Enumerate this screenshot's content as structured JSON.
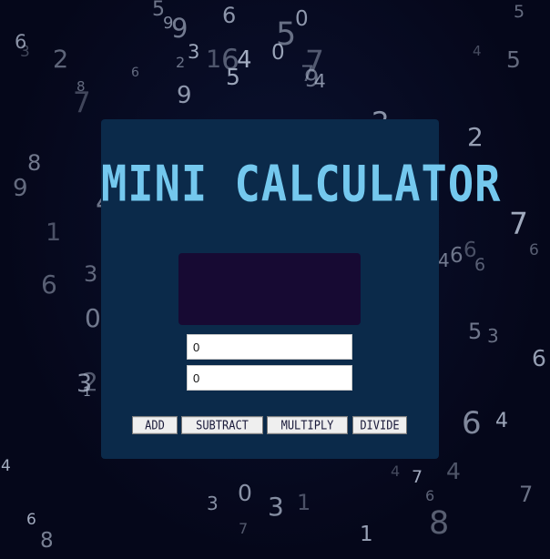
{
  "background_digits": [
    "7",
    "0",
    "1",
    "6",
    "0",
    "6",
    "7",
    "1",
    "6",
    "9",
    "3",
    "6",
    "8",
    "4",
    "3",
    "5",
    "6",
    "0",
    "7",
    "6",
    "9",
    "3",
    "5",
    "4",
    "5",
    "6",
    "1",
    "2",
    "3",
    "4",
    "8",
    "7",
    "7",
    "1",
    "6",
    "8",
    "9",
    "4",
    "9",
    "6",
    "5",
    "3",
    "7",
    "4",
    "6",
    "8",
    "9",
    "0",
    "1",
    "2",
    "2",
    "5",
    "6",
    "3",
    "4",
    "7",
    "9",
    "6",
    "1",
    "8",
    "4",
    "9",
    "8",
    "7",
    "6",
    "0",
    "3",
    "2",
    "4",
    "5",
    "9",
    "5",
    "1",
    "4",
    "6",
    "5",
    "7",
    "2",
    "3",
    "0",
    "8",
    "6",
    "2",
    "1",
    "4",
    "9",
    "7",
    "0",
    "3",
    "6",
    "1",
    "5",
    "8",
    "2",
    "4",
    "3",
    "9",
    "7",
    "6",
    "2",
    "3",
    "5",
    "9",
    "0",
    "4",
    "8",
    "3",
    "5"
  ],
  "calculator": {
    "title": "MINI CALCULATOR",
    "display_text": "",
    "first_operand": "0",
    "second_operand": "0",
    "buttons": {
      "add": "ADD",
      "subtract": "SUBTRACT",
      "multiply": "MULTIPLY",
      "divide": "DIVIDE"
    }
  },
  "colors": {
    "page_background": "#05071a",
    "panel": "#0b2a4a",
    "title": "#74c8ee",
    "display": "#170a33"
  }
}
